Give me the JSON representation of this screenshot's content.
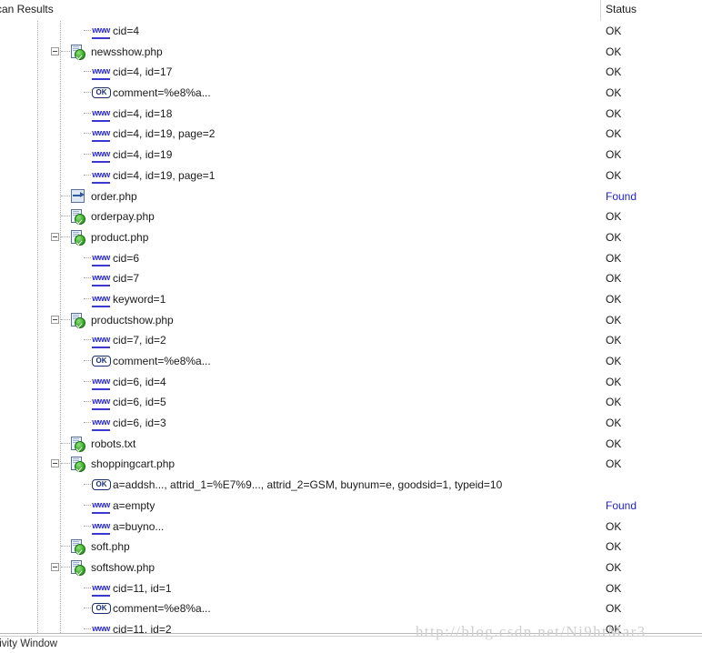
{
  "window": {
    "header_tree_label": "can Results",
    "header_status_label": "Status",
    "footer_label": "tivity Window",
    "watermark": "http://blog.csdn.net/Ni9htMar3"
  },
  "colors": {
    "status_ok": "#1a1a1a",
    "status_found": "#2222cc",
    "tree_line": "#a8a8a8",
    "link_blue": "#2828c8"
  },
  "columns": [
    "can Results",
    "Status"
  ],
  "rows": [
    {
      "label": "cid=4",
      "icon": "www-icon",
      "status": "OK",
      "depth": 2,
      "expander": "none"
    },
    {
      "label": "newsshow.php",
      "icon": "page-ok-icon",
      "status": "OK",
      "depth": 1,
      "expander": "minus"
    },
    {
      "label": "cid=4, id=17",
      "icon": "www-icon",
      "status": "OK",
      "depth": 2,
      "expander": "none"
    },
    {
      "label": "comment=%e8%a...",
      "icon": "ok-badge-icon",
      "status": "OK",
      "depth": 2,
      "expander": "none"
    },
    {
      "label": "cid=4, id=18",
      "icon": "www-icon",
      "status": "OK",
      "depth": 2,
      "expander": "none"
    },
    {
      "label": "cid=4, id=19, page=2",
      "icon": "www-icon",
      "status": "OK",
      "depth": 2,
      "expander": "none"
    },
    {
      "label": "cid=4, id=19",
      "icon": "www-icon",
      "status": "OK",
      "depth": 2,
      "expander": "none"
    },
    {
      "label": "cid=4, id=19, page=1",
      "icon": "www-icon",
      "status": "OK",
      "depth": 2,
      "expander": "none"
    },
    {
      "label": "order.php",
      "icon": "page-arrow-icon",
      "status": "Found",
      "depth": 1,
      "expander": "none"
    },
    {
      "label": "orderpay.php",
      "icon": "page-ok-icon",
      "status": "OK",
      "depth": 1,
      "expander": "none"
    },
    {
      "label": "product.php",
      "icon": "page-ok-icon",
      "status": "OK",
      "depth": 1,
      "expander": "minus"
    },
    {
      "label": "cid=6",
      "icon": "www-icon",
      "status": "OK",
      "depth": 2,
      "expander": "none"
    },
    {
      "label": "cid=7",
      "icon": "www-icon",
      "status": "OK",
      "depth": 2,
      "expander": "none"
    },
    {
      "label": "keyword=1",
      "icon": "www-icon",
      "status": "OK",
      "depth": 2,
      "expander": "none"
    },
    {
      "label": "productshow.php",
      "icon": "page-ok-icon",
      "status": "OK",
      "depth": 1,
      "expander": "minus"
    },
    {
      "label": "cid=7, id=2",
      "icon": "www-icon",
      "status": "OK",
      "depth": 2,
      "expander": "none"
    },
    {
      "label": "comment=%e8%a...",
      "icon": "ok-badge-icon",
      "status": "OK",
      "depth": 2,
      "expander": "none"
    },
    {
      "label": "cid=6, id=4",
      "icon": "www-icon",
      "status": "OK",
      "depth": 2,
      "expander": "none"
    },
    {
      "label": "cid=6, id=5",
      "icon": "www-icon",
      "status": "OK",
      "depth": 2,
      "expander": "none"
    },
    {
      "label": "cid=6, id=3",
      "icon": "www-icon",
      "status": "OK",
      "depth": 2,
      "expander": "none"
    },
    {
      "label": "robots.txt",
      "icon": "page-ok-icon",
      "status": "OK",
      "depth": 1,
      "expander": "none"
    },
    {
      "label": "shoppingcart.php",
      "icon": "page-ok-icon",
      "status": "OK",
      "depth": 1,
      "expander": "minus"
    },
    {
      "label": "a=addsh..., attrid_1=%E7%9..., attrid_2=GSM, buynum=e, goodsid=1, typeid=10",
      "icon": "ok-badge-icon",
      "status": "",
      "depth": 2,
      "expander": "none"
    },
    {
      "label": "a=empty",
      "icon": "www-icon",
      "status": "Found",
      "depth": 2,
      "expander": "none"
    },
    {
      "label": "a=buyno...",
      "icon": "www-icon",
      "status": "OK",
      "depth": 2,
      "expander": "none"
    },
    {
      "label": "soft.php",
      "icon": "page-ok-icon",
      "status": "OK",
      "depth": 1,
      "expander": "none"
    },
    {
      "label": "softshow.php",
      "icon": "page-ok-icon",
      "status": "OK",
      "depth": 1,
      "expander": "minus"
    },
    {
      "label": "cid=11, id=1",
      "icon": "www-icon",
      "status": "OK",
      "depth": 2,
      "expander": "none"
    },
    {
      "label": "comment=%e8%a...",
      "icon": "ok-badge-icon",
      "status": "OK",
      "depth": 2,
      "expander": "none"
    },
    {
      "label": "cid=11, id=2",
      "icon": "www-icon",
      "status": "OK",
      "depth": 2,
      "expander": "none"
    }
  ],
  "icon_glyphs": {
    "www-icon": "www",
    "ok-badge-icon": "OK"
  }
}
